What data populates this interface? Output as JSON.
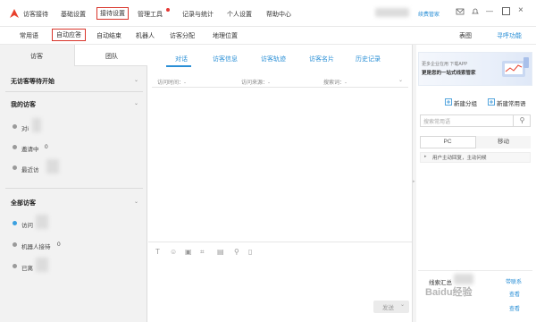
{
  "topbar": {
    "menu": [
      "访客接待",
      "基础设置",
      "接待设置",
      "管理工具",
      "记录与统计",
      "个人设置",
      "帮助中心"
    ],
    "right_link": "续费管家",
    "colors": {
      "accent": "#2a8fd6",
      "highlight_box": "#d9352b",
      "notification_dot": "#e53935"
    }
  },
  "subbar": {
    "items": [
      "常用语",
      "自动应答",
      "自动结束",
      "机器人",
      "访客分配",
      "地理位置"
    ],
    "right_items": [
      "表图",
      "寻呼功能"
    ]
  },
  "left": {
    "tabs": [
      "访客",
      "团队"
    ],
    "section_waiting": "无访客等待开始",
    "section_mine": "我的访客",
    "mine_items": [
      {
        "label": "对i",
        "count": ""
      },
      {
        "label": "邀请中",
        "count": "0"
      },
      {
        "label": "最近访",
        "count": ""
      }
    ],
    "section_all": "全部访客",
    "all_items": [
      {
        "label": "访问",
        "count": ""
      },
      {
        "label": "机器人接待",
        "count": "0"
      },
      {
        "label": "已离",
        "count": ""
      }
    ]
  },
  "center": {
    "tabs": [
      "对话",
      "访客信息",
      "访客轨迹",
      "访客名片",
      "历史记录"
    ],
    "fields": [
      "访问时间：-",
      "访问来源：-",
      "搜索词：-"
    ],
    "toolbar_icons": [
      "text-icon",
      "emoji-icon",
      "image-icon",
      "screenshot-icon",
      "file-icon",
      "location-icon",
      "voice-icon"
    ],
    "send_label": "发送"
  },
  "right": {
    "banner_line1": "更多企业在用 下载APP",
    "banner_line2": "更是您的一站式线索管家",
    "new_group": "新建分组",
    "new_phrase": "新建常用语",
    "search_placeholder": "搜索常用语",
    "tabs": [
      "PC",
      "移动"
    ],
    "list_item": "用户主动回复，主动问候",
    "bottom_title": "线索汇总",
    "bottom_link": "带联系",
    "bottom_link2": "查看",
    "bottom_link3": "查看"
  },
  "watermark": "Baidu经验"
}
